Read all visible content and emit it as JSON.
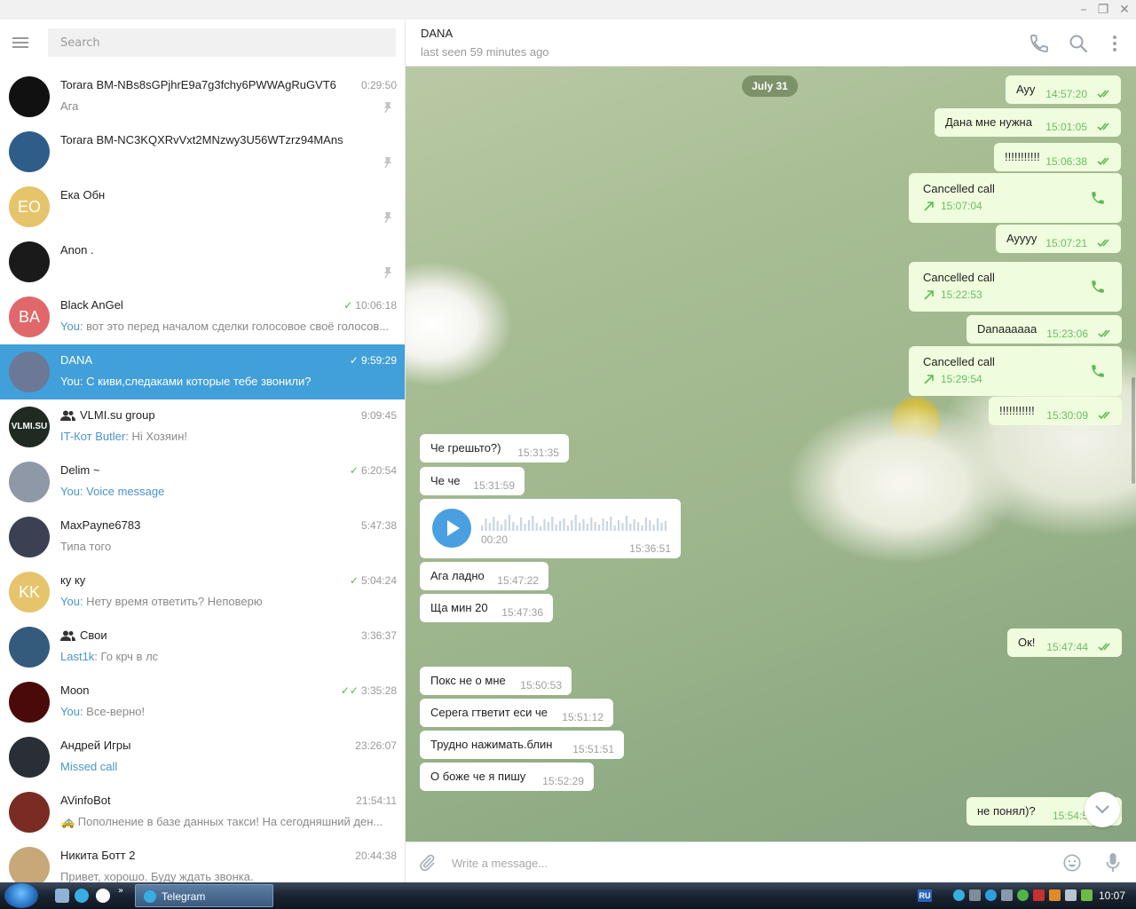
{
  "window": {
    "controls": [
      "minimize",
      "restore",
      "close"
    ]
  },
  "search": {
    "placeholder": "Search"
  },
  "chats": [
    {
      "name": "Torara BM-NBs8sGPjhrE9a7g3fchy6PWWAgRuGVT6",
      "time": "0:29:50",
      "who": "",
      "preview": "Ага",
      "pinned": true,
      "avatar_color": "#111111",
      "initials": ""
    },
    {
      "name": "Torara BM-NC3KQXRvVxt2MNzwy3U56WTzrz94MAns",
      "time": "",
      "who": "",
      "preview": "",
      "pinned": true,
      "avatar_color": "#2f5d8a",
      "initials": ""
    },
    {
      "name": "Ека Обн",
      "time": "",
      "who": "",
      "preview": "",
      "pinned": true,
      "avatar_color": "#e6c46b",
      "initials": "EO"
    },
    {
      "name": "Anon .",
      "time": "",
      "who": "",
      "preview": "",
      "pinned": true,
      "avatar_color": "#1a1a1a",
      "initials": ""
    },
    {
      "name": "Black AnGel",
      "time": "10:06:18",
      "who": "You:",
      "preview": " вот это перед началом сделки голосовое своё голосов...",
      "tick": "single",
      "avatar_color": "#e1686a",
      "initials": "BA"
    },
    {
      "name": "DANA",
      "time": "9:59:29",
      "who": "You:",
      "preview": " С киви,следаками которые тебе звонили?",
      "tick": "single",
      "active": true,
      "avatar_color": "#6b7896",
      "initials": ""
    },
    {
      "name": "VLMI.su group",
      "time": "9:09:45",
      "who": "IT-Кот Butler:",
      "preview": " Hi Хозяин!",
      "group": true,
      "avatar_color": "#1e2a22",
      "initials": "VLMI.SU"
    },
    {
      "name": "Delim ~",
      "time": "6:20:54",
      "who": "You:",
      "preview": " Voice message",
      "tick": "single",
      "preview_link": true,
      "avatar_color": "#8e98a6",
      "initials": ""
    },
    {
      "name": "MaxPayne6783",
      "time": "5:47:38",
      "who": "",
      "preview": "Типа того",
      "avatar_color": "#3b4152",
      "initials": ""
    },
    {
      "name": "ку ку",
      "time": "5:04:24",
      "who": "You:",
      "preview": " Нету время ответить? Неповерю",
      "tick": "single",
      "avatar_color": "#e6c46b",
      "initials": "KK"
    },
    {
      "name": "Свои",
      "time": "3:36:37",
      "who": "Last1k:",
      "preview": " Го крч в лс",
      "group": true,
      "avatar_color": "#345a7c",
      "initials": ""
    },
    {
      "name": "Moon",
      "time": "3:35:28",
      "who": "You:",
      "preview": " Все-верно!",
      "tick": "double",
      "avatar_color": "#4a0a0a",
      "initials": ""
    },
    {
      "name": "Андрей Игры",
      "time": "23:26:07",
      "who": "",
      "preview": "Missed call",
      "preview_link": true,
      "avatar_color": "#2a2e36",
      "initials": ""
    },
    {
      "name": "AVinfoBot",
      "time": "21:54:11",
      "who": "",
      "preview": "🚕 Пополнение в базе данных такси! На сегодняшний ден...",
      "avatar_color": "#7a2c24",
      "initials": ""
    },
    {
      "name": "Никита Ботт 2",
      "time": "20:44:38",
      "who": "",
      "preview": "Привет, хорошо. Буду ждать звонка.",
      "avatar_color": "#c8a878",
      "initials": ""
    }
  ],
  "header": {
    "name": "DANA",
    "status": "last seen 59 minutes ago"
  },
  "date_badge": "July 31",
  "messages_out": [
    {
      "text": "Ayy",
      "time": "14:57:20",
      "x": 0,
      "y": 0
    },
    {
      "text": "Дана мне нужна",
      "time": "15:01:05"
    },
    {
      "text": "!!!!!!!!!!!",
      "time": "15:06:38"
    },
    {
      "text": "Ayyyy",
      "time": "15:07:21"
    },
    {
      "text": "Danaaaaaa",
      "time": "15:23:06"
    },
    {
      "text": "!!!!!!!!!!!",
      "time": "15:30:09"
    },
    {
      "text": "Ок!",
      "time": "15:47:44"
    },
    {
      "text": "не понял)?",
      "time": "15:54:5"
    }
  ],
  "calls": [
    {
      "title": "Cancelled call",
      "time": "15:07:04"
    },
    {
      "title": "Cancelled call",
      "time": "15:22:53"
    },
    {
      "title": "Cancelled call",
      "time": "15:29:54"
    }
  ],
  "messages_in": [
    {
      "text": "Че грешьто?)",
      "time": "15:31:35"
    },
    {
      "text": "Че че",
      "time": "15:31:59"
    },
    {
      "text": "Ага ладно",
      "time": "15:47:22"
    },
    {
      "text": "Ща мин 20",
      "time": "15:47:36"
    },
    {
      "text": "Покс не о мне",
      "time": "15:50:53"
    },
    {
      "text": "Серега гтветит еси че",
      "time": "15:51:12"
    },
    {
      "text": "Трудно нажимать.блин",
      "time": "15:51:51"
    },
    {
      "text": "О боже че я пишу",
      "time": "15:52:29"
    }
  ],
  "voice": {
    "duration": "00:20",
    "time": "15:36:51"
  },
  "composer": {
    "placeholder": "Write a message..."
  },
  "taskbar": {
    "app_label": "Telegram",
    "lang": "RU",
    "clock": "10:07"
  },
  "colors": {
    "accent": "#419fd9",
    "out_bubble": "#effdde",
    "check_green": "#4dbd47"
  }
}
